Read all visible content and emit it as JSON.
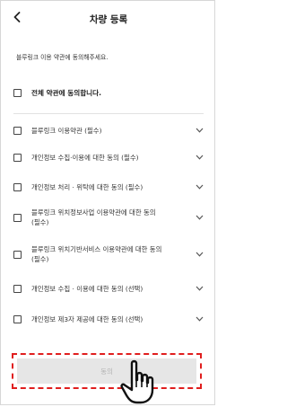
{
  "header": {
    "title": "차량 등록"
  },
  "guide": "블루링크 이용 약관에 동의해주세요.",
  "agree_all": {
    "label": "전체 약관에 동의합니다."
  },
  "terms": [
    {
      "label": "블루링크 이용약관 (필수)"
    },
    {
      "label": "개인정보 수집·이용에 대한 동의 (필수)"
    },
    {
      "label": "개인정보 처리 · 위탁에 대한 동의 (필수)"
    },
    {
      "label": "블루링크 위치정보사업 이용약관에 대한 동의 (필수)"
    },
    {
      "label": "블루링크 위치기반서비스 이용약관에 대한 동의 (필수)"
    },
    {
      "label": "개인정보 수집 · 이용에 대한 동의 (선택)"
    },
    {
      "label": "개인정보 제3자 제공에 대한 동의 (선택)"
    }
  ],
  "confirm": {
    "label": "동의"
  },
  "colors": {
    "highlight": "#e01e1e",
    "button_bg": "#e6e6e6",
    "button_text": "#b3b3b3"
  },
  "icons": [
    "back-arrow-icon",
    "checkbox-icon",
    "chevron-down-icon",
    "pointing-hand-icon"
  ]
}
